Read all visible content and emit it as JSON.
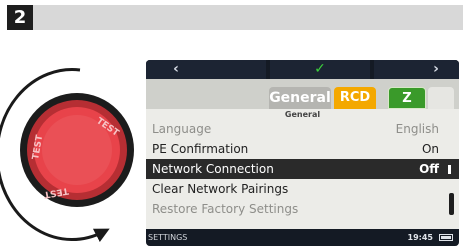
{
  "step": {
    "number": "2"
  },
  "device": {
    "nav": {
      "left_glyph": "‹",
      "check_glyph": "✓",
      "right_glyph": "›"
    },
    "tabs": {
      "general": "General",
      "rcd": "RCD",
      "z": "Z"
    },
    "section_title": "General",
    "menu": [
      {
        "label": "Language",
        "value": "English",
        "state": "dim"
      },
      {
        "label": "PE Confirmation",
        "value": "On",
        "state": "normal"
      },
      {
        "label": "Network Connection",
        "value": "Off",
        "state": "selected"
      },
      {
        "label": "Clear Network Pairings",
        "value": "",
        "state": "normal"
      },
      {
        "label": "Restore Factory Settings",
        "value": "",
        "state": "faded"
      }
    ],
    "status": {
      "left_text": "SETTINGS",
      "time": "19:45"
    }
  },
  "dial": {
    "label_top": "TEST",
    "label_left": "TEST",
    "label_bottom": "TEST"
  },
  "colors": {
    "dial_red": "#e8434a",
    "tab_rcd": "#f4a800",
    "tab_z": "#3a9a2a",
    "check": "#3cd03c"
  }
}
